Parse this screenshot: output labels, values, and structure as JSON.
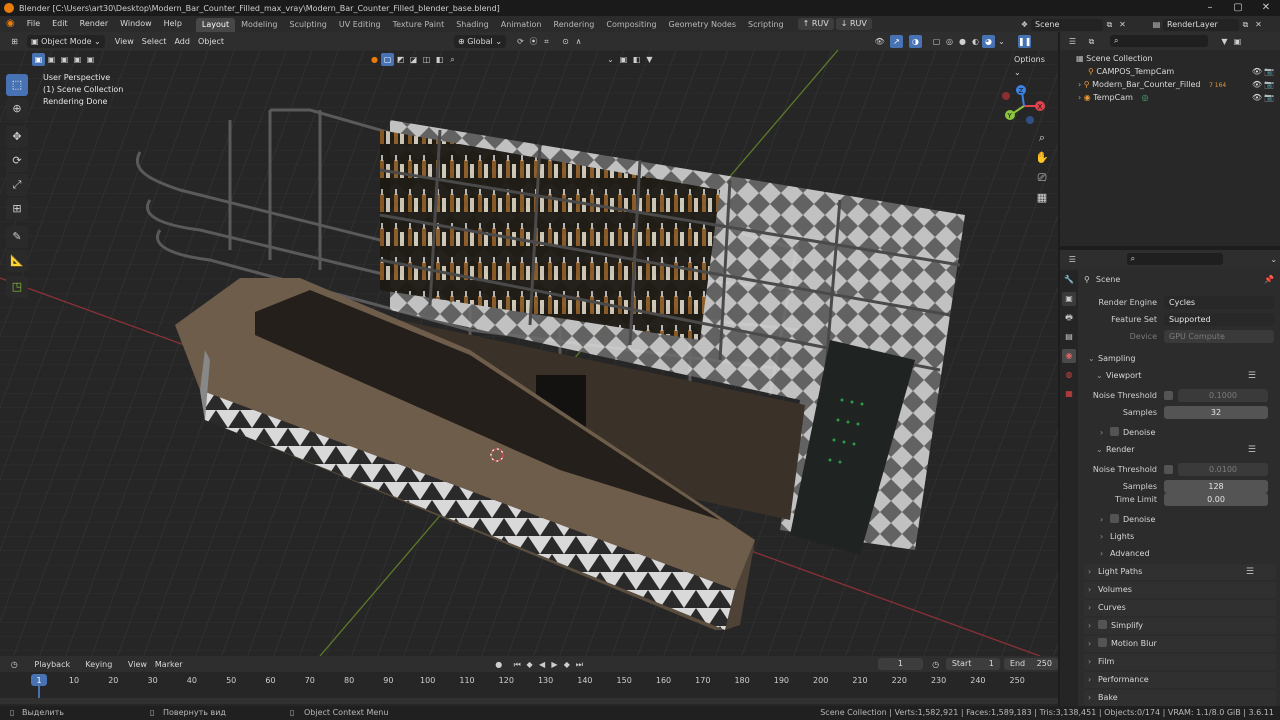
{
  "window": {
    "title": "Blender [C:\\Users\\art30\\Desktop\\Modern_Bar_Counter_Filled_max_vray\\Modern_Bar_Counter_Filled_blender_base.blend]"
  },
  "menus": [
    "File",
    "Edit",
    "Render",
    "Window",
    "Help"
  ],
  "workspaces": [
    "Layout",
    "Modeling",
    "Sculpting",
    "UV Editing",
    "Texture Paint",
    "Shading",
    "Animation",
    "Rendering",
    "Compositing",
    "Geometry Nodes",
    "Scripting"
  ],
  "active_workspace": "Layout",
  "ruv_buttons": [
    "RUV",
    "RUV"
  ],
  "scene_field": "Scene",
  "renderlayer_field": "RenderLayer",
  "viewport_header": {
    "mode": "Object Mode",
    "menus": [
      "View",
      "Select",
      "Add",
      "Object"
    ],
    "transform_orientation": "Global",
    "options_label": "Options"
  },
  "viewport_overlay": {
    "line1": "User Perspective",
    "line2": "(1) Scene Collection",
    "line3": "Rendering Done"
  },
  "gizmo_axes": [
    "X",
    "Y",
    "Z"
  ],
  "outliner": {
    "root": "Scene Collection",
    "items": [
      {
        "label": "CAMPOS_TempCam",
        "badge": ""
      },
      {
        "label": "Modern_Bar_Counter_Filled",
        "badge": "7 164"
      },
      {
        "label": "TempCam",
        "badge": ""
      }
    ]
  },
  "properties": {
    "context": "Scene",
    "render_engine_label": "Render Engine",
    "render_engine": "Cycles",
    "feature_set_label": "Feature Set",
    "feature_set": "Supported",
    "device_label": "Device",
    "device": "GPU Compute",
    "sampling": "Sampling",
    "viewport": "Viewport",
    "noise_threshold_label": "Noise Threshold",
    "viewport_noise_threshold": "0.1000",
    "samples_label": "Samples",
    "viewport_samples": "32",
    "denoise": "Denoise",
    "render": "Render",
    "render_noise_threshold": "0.0100",
    "render_samples": "128",
    "time_limit_label": "Time Limit",
    "time_limit": "0.00",
    "render_denoise": "Denoise",
    "lights": "Lights",
    "advanced": "Advanced",
    "sections": [
      "Light Paths",
      "Volumes",
      "Curves",
      "Simplify",
      "Motion Blur",
      "Film",
      "Performance",
      "Bake"
    ]
  },
  "timeline": {
    "menus": [
      "Playback",
      "Keying",
      "View",
      "Marker"
    ],
    "current_frame": "1",
    "start_label": "Start",
    "start": "1",
    "end_label": "End",
    "end": "250",
    "ticks": [
      "1",
      "10",
      "20",
      "30",
      "40",
      "50",
      "60",
      "70",
      "80",
      "90",
      "100",
      "110",
      "120",
      "130",
      "140",
      "150",
      "160",
      "170",
      "180",
      "190",
      "200",
      "210",
      "220",
      "230",
      "240",
      "250"
    ]
  },
  "statusbar": {
    "select": "Выделить",
    "rotate": "Повернуть вид",
    "context_menu": "Object Context Menu",
    "stats": "Scene Collection | Verts:1,582,921 | Faces:1,589,183 | Tris:3,138,451 | Objects:0/174 | VRAM: 1.1/8.0 GiB | 3.6.11"
  },
  "colors": {
    "accent_blue": "#4772b3",
    "blender_orange": "#e87d0d",
    "axis_x": "#e0444a",
    "axis_y": "#8cc43e",
    "axis_z": "#3c82e3"
  }
}
